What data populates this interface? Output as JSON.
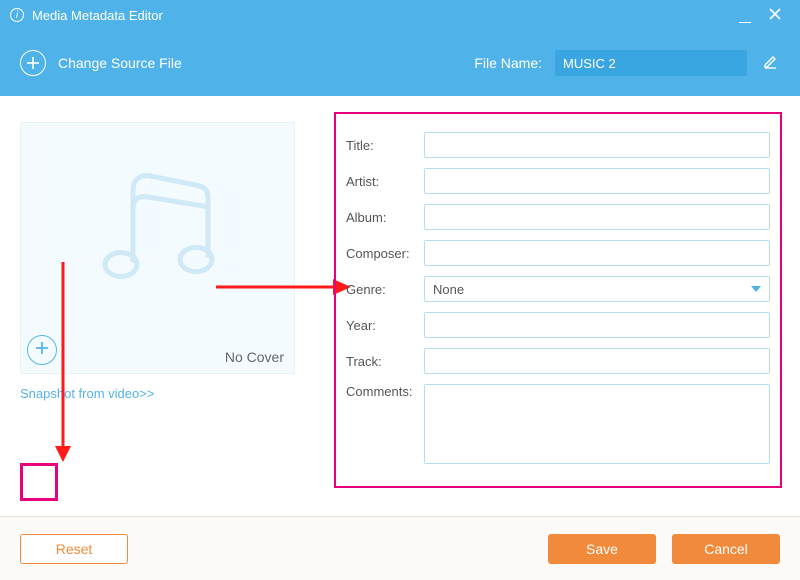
{
  "titlebar": {
    "title": "Media Metadata Editor"
  },
  "subheader": {
    "change_source": "Change Source File",
    "file_name_label": "File Name:",
    "file_name_value": "MUSIC 2"
  },
  "cover": {
    "no_cover": "No Cover",
    "snapshot_link": "Snapshot from video>>"
  },
  "form": {
    "labels": {
      "title": "Title:",
      "artist": "Artist:",
      "album": "Album:",
      "composer": "Composer:",
      "genre": "Genre:",
      "year": "Year:",
      "track": "Track:",
      "comments": "Comments:"
    },
    "values": {
      "title": "",
      "artist": "",
      "album": "",
      "composer": "",
      "genre": "None",
      "year": "",
      "track": "",
      "comments": ""
    }
  },
  "footer": {
    "reset": "Reset",
    "save": "Save",
    "cancel": "Cancel"
  }
}
